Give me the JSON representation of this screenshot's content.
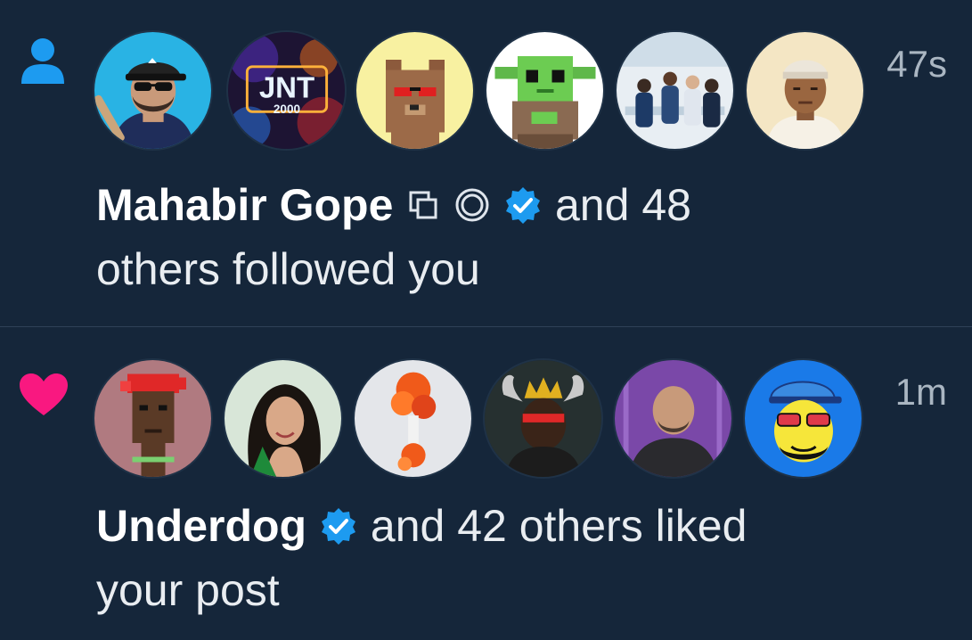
{
  "colors": {
    "background": "#15263a",
    "follow_icon": "#1d9bf0",
    "like_icon": "#f91880",
    "verified": "#1d9bf0"
  },
  "notifications": [
    {
      "type": "follow",
      "icon": "person-icon",
      "timestamp": "47s",
      "actor": "Mahabir Gope",
      "actor_badges": [
        "copy-squares-icon",
        "ring-icon",
        "verified-badge-icon"
      ],
      "message_line1": "and 48",
      "message_line2": "others followed you",
      "avatars": [
        "baseball-cap-avatar",
        "jnt-2000-avatar",
        "pixel-bear-avatar",
        "baby-yoda-avatar",
        "office-team-avatar",
        "kufi-cap-avatar"
      ]
    },
    {
      "type": "like",
      "icon": "heart-icon",
      "timestamp": "1m",
      "actor": "Underdog",
      "actor_badges": [
        "verified-badge-icon"
      ],
      "message_line1": "and 42 others liked",
      "message_line2": "your post",
      "avatars": [
        "pixel-punk-avatar",
        "woman-avatar",
        "orange-sculpture-avatar",
        "crowned-horns-avatar",
        "bald-man-avatar",
        "yellow-cartoon-avatar"
      ]
    }
  ],
  "avatar_text": {
    "jnt": "JNT",
    "jnt_year": "2000"
  }
}
